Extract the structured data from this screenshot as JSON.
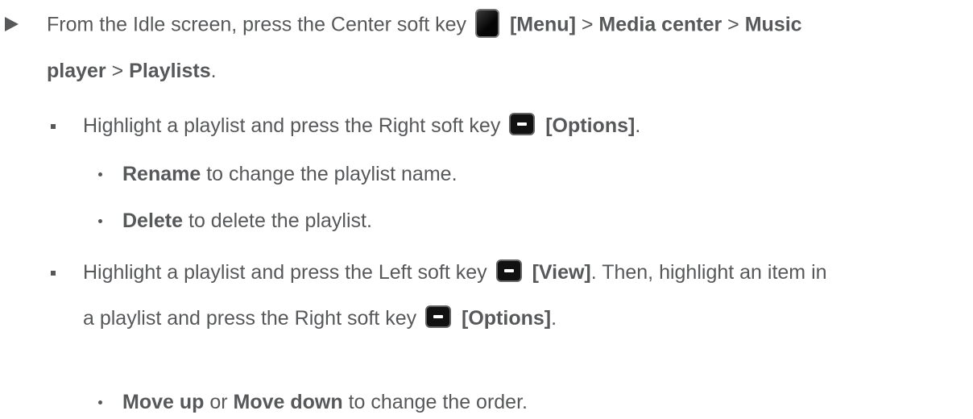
{
  "step": {
    "text1": "From the Idle screen, press the Center soft key",
    "menu": "[Menu]",
    "sep1": " > ",
    "media_center": "Media center",
    "sep2": " > ",
    "music": "Music",
    "player": "player",
    "sep3": " > ",
    "playlists": "Playlists",
    "end": "."
  },
  "bullet1": {
    "text": "Highlight a playlist and press the Right soft key",
    "options": "[Options]",
    "end": ".",
    "sub": [
      {
        "bold": "Rename",
        "text": " to change the playlist name."
      },
      {
        "bold": "Delete",
        "text": " to delete the playlist."
      }
    ]
  },
  "bullet2": {
    "text": "Highlight a playlist and press the Left soft key",
    "view": "[View]",
    "then": ". Then, highlight an item in",
    "line2": "a playlist and press the Right soft key",
    "options": "[Options]",
    "end": ".",
    "sub": [
      {
        "bold1": "Move up",
        "mid": " or ",
        "bold2": "Move down",
        "text": " to change the order."
      }
    ]
  },
  "icons": {
    "center_key": "center-soft-key-icon",
    "soft_key": "soft-key-icon"
  }
}
